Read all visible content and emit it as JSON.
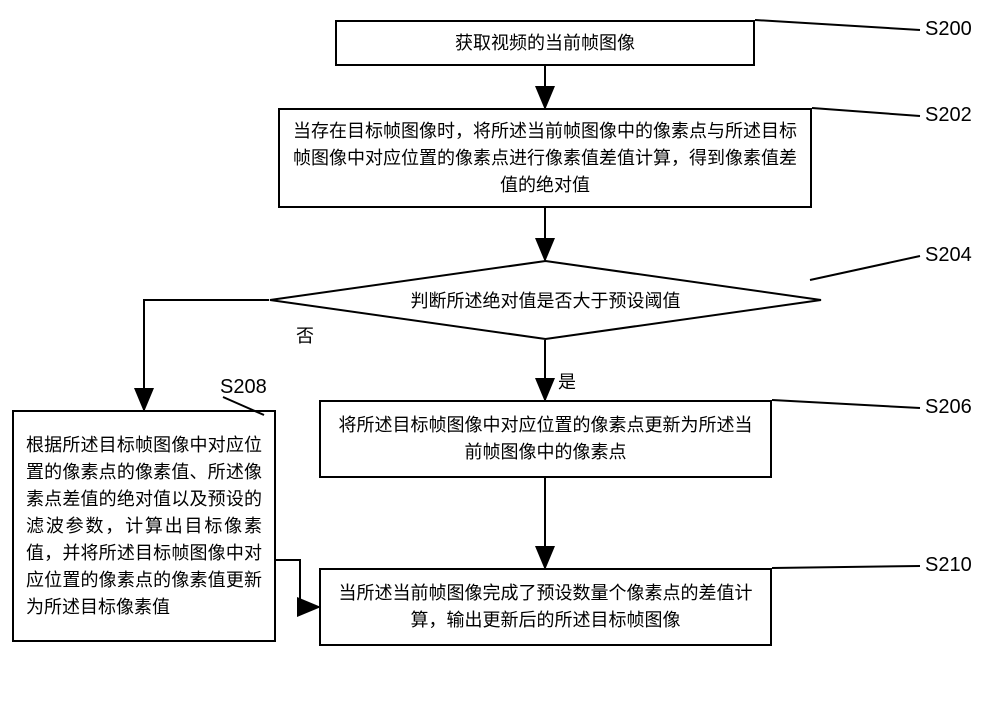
{
  "steps": {
    "s200": {
      "label": "S200",
      "text": "获取视频的当前帧图像"
    },
    "s202": {
      "label": "S202",
      "text": "当存在目标帧图像时，将所述当前帧图像中的像素点与所述目标帧图像中对应位置的像素点进行像素值差值计算，得到像素值差值的绝对值"
    },
    "s204": {
      "label": "S204",
      "text": "判断所述绝对值是否大于预设阈值"
    },
    "s206": {
      "label": "S206",
      "text": "将所述目标帧图像中对应位置的像素点更新为所述当前帧图像中的像素点"
    },
    "s208": {
      "label": "S208",
      "text": "根据所述目标帧图像中对应位置的像素点的像素值、所述像素点差值的绝对值以及预设的滤波参数，计算出目标像素值，并将所述目标帧图像中对应位置的像素点的像素值更新为所述目标像素值"
    },
    "s210": {
      "label": "S210",
      "text": "当所述当前帧图像完成了预设数量个像素点的差值计算，输出更新后的所述目标帧图像"
    }
  },
  "edges": {
    "yes": "是",
    "no": "否"
  }
}
